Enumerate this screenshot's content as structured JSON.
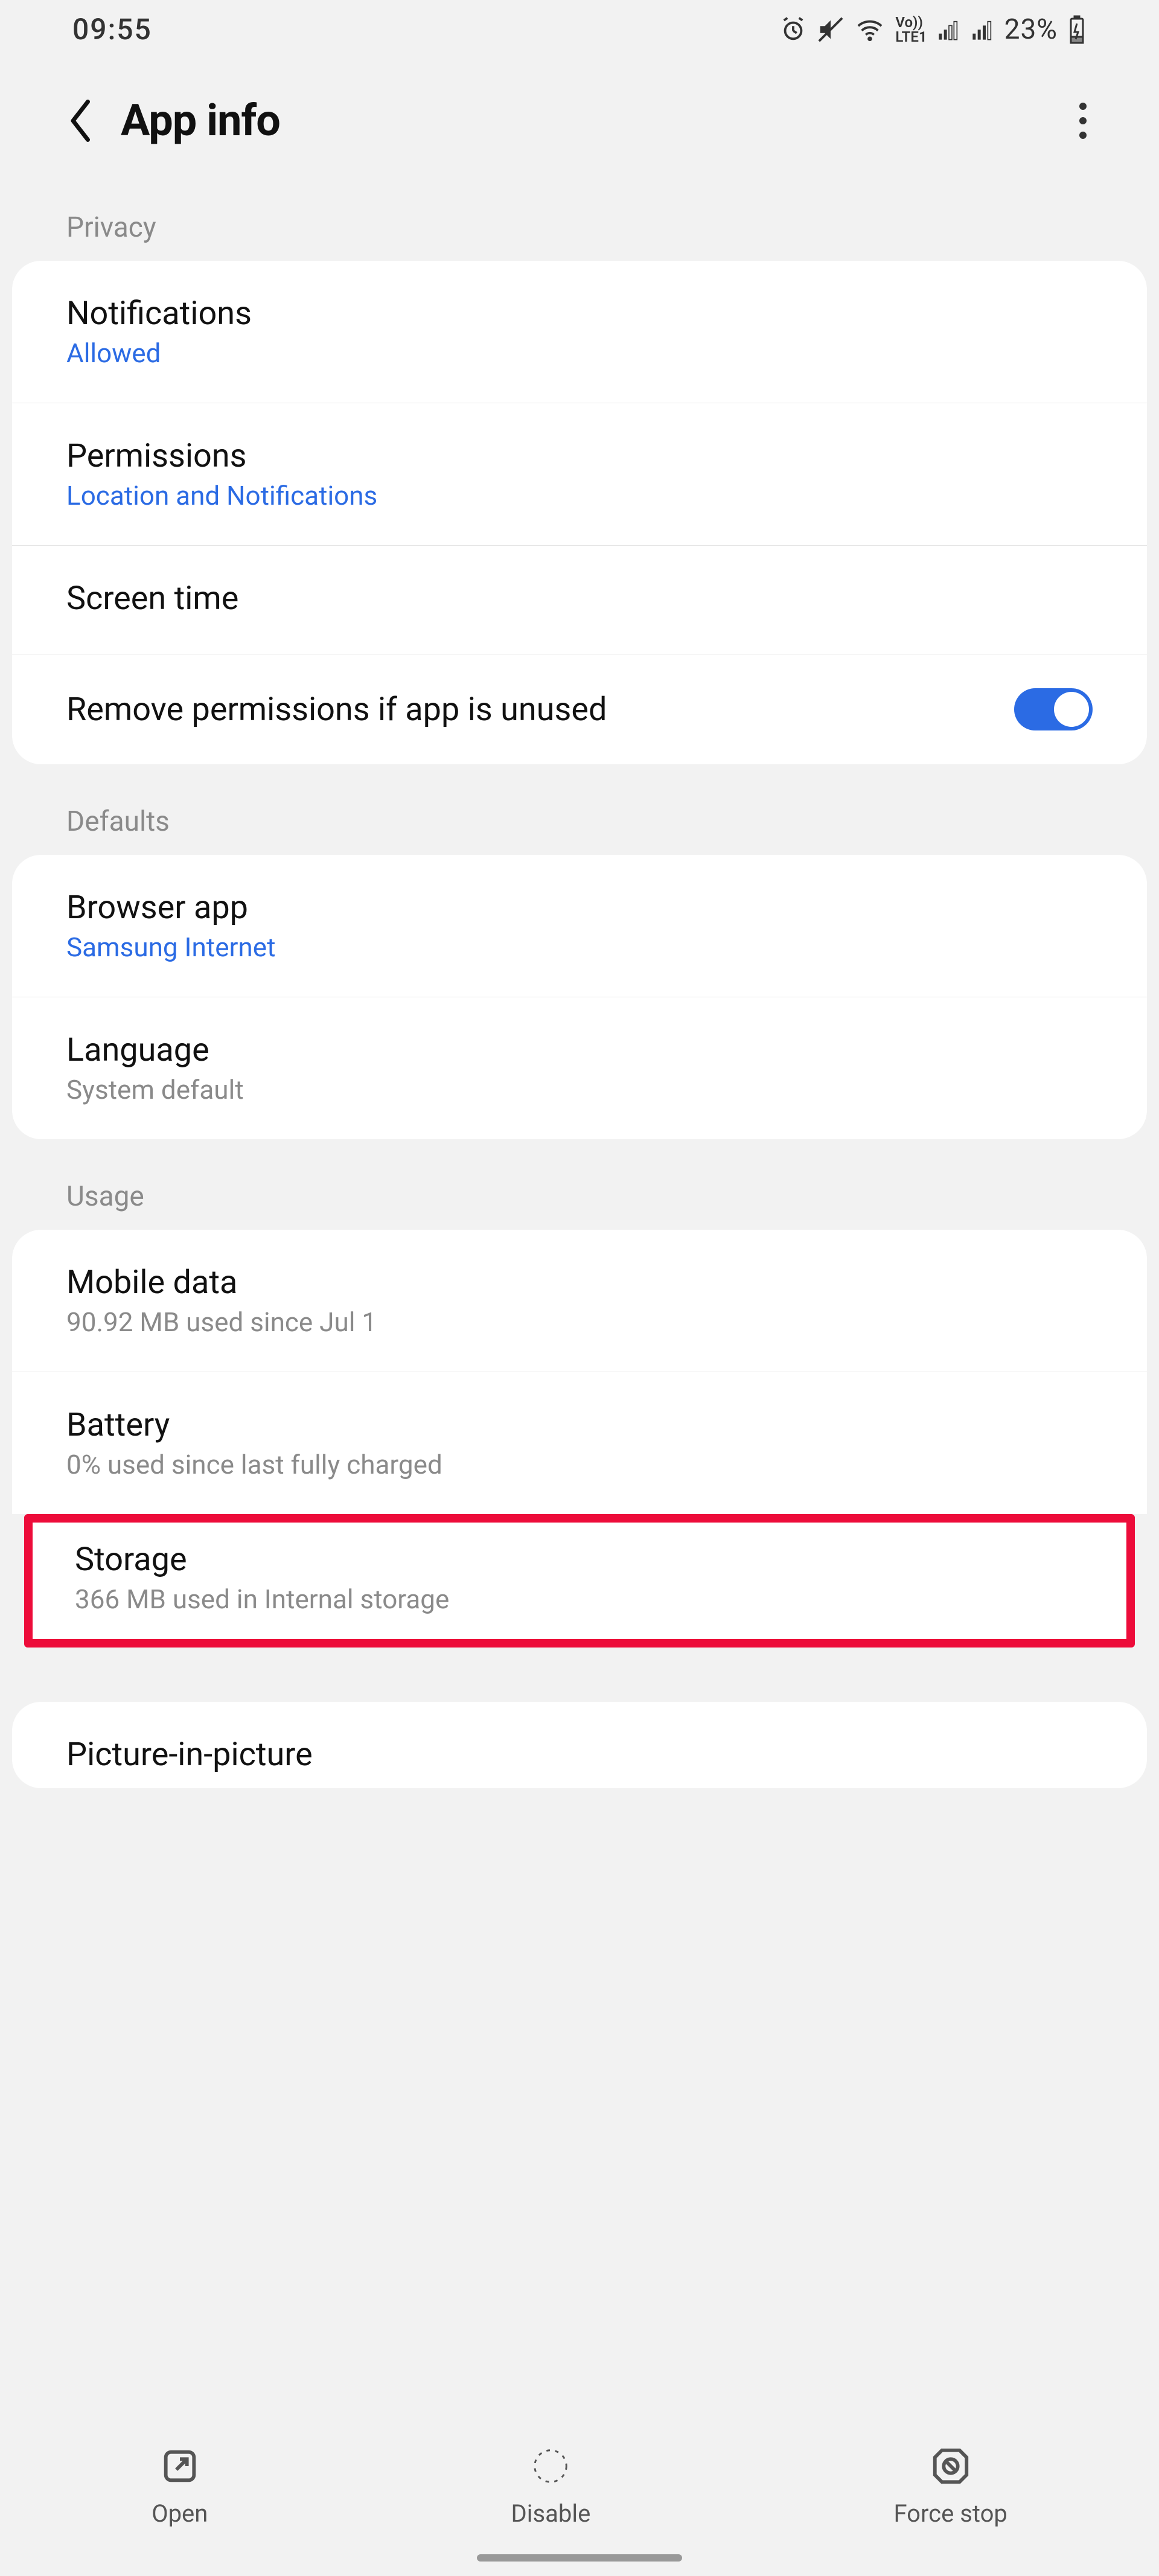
{
  "status": {
    "time": "09:55",
    "battery": "23%"
  },
  "header": {
    "title": "App info"
  },
  "sections": {
    "privacy": {
      "label": "Privacy",
      "notifications": {
        "title": "Notifications",
        "sub": "Allowed"
      },
      "permissions": {
        "title": "Permissions",
        "sub": "Location and Notifications"
      },
      "screen_time": {
        "title": "Screen time"
      },
      "remove_perms": {
        "title": "Remove permissions if app is unused"
      }
    },
    "defaults": {
      "label": "Defaults",
      "browser": {
        "title": "Browser app",
        "sub": "Samsung Internet"
      },
      "language": {
        "title": "Language",
        "sub": "System default"
      }
    },
    "usage": {
      "label": "Usage",
      "mobile_data": {
        "title": "Mobile data",
        "sub": "90.92 MB used since Jul 1"
      },
      "battery": {
        "title": "Battery",
        "sub": "0% used since last fully charged"
      },
      "storage": {
        "title": "Storage",
        "sub": "366 MB used in Internal storage"
      }
    },
    "extra": {
      "pip": {
        "title": "Picture-in-picture"
      }
    }
  },
  "bottom": {
    "open": "Open",
    "disable": "Disable",
    "force_stop": "Force stop"
  }
}
